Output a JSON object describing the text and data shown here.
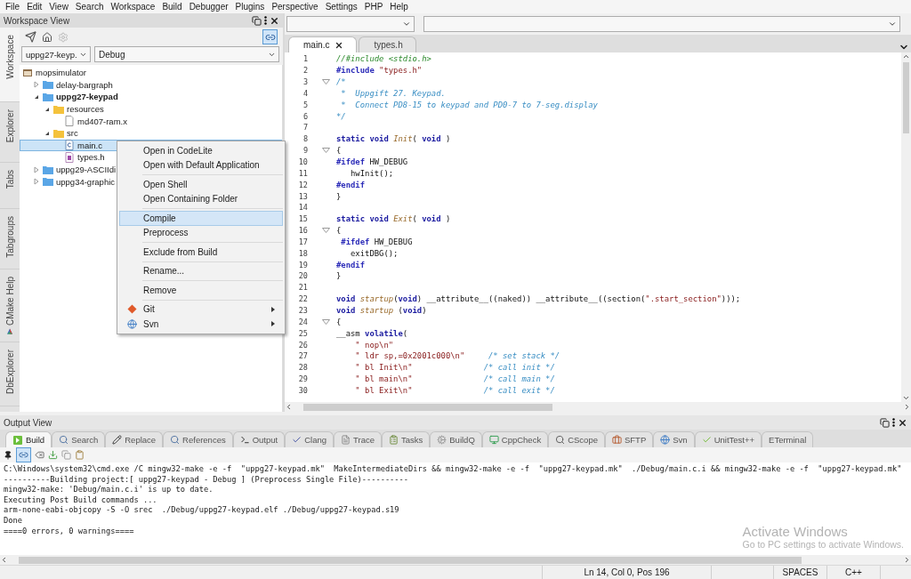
{
  "menu_bar": [
    "File",
    "Edit",
    "View",
    "Search",
    "Workspace",
    "Build",
    "Debugger",
    "Plugins",
    "Perspective",
    "Settings",
    "PHP",
    "Help"
  ],
  "workspace_view": {
    "title": "Workspace View",
    "side_tabs": [
      {
        "label": "Workspace",
        "selected": true
      },
      {
        "label": "Explorer",
        "selected": false
      },
      {
        "label": "Tabs",
        "selected": false
      },
      {
        "label": "Tabgroups",
        "selected": false
      },
      {
        "label": "CMake Help",
        "selected": false
      },
      {
        "label": "DbExplorer",
        "selected": false
      }
    ],
    "link_editor": {
      "on": true
    },
    "project_combo": {
      "value": "uppg27-keyp."
    },
    "config_combo": {
      "value": "Debug"
    },
    "tree": [
      {
        "label": "mopsimulator",
        "kind": "workspace",
        "selected": false,
        "children": [
          {
            "label": "delay-bargraph",
            "kind": "project",
            "expanded": false,
            "active": false,
            "selected": false
          },
          {
            "label": "uppg27-keypad",
            "kind": "project",
            "expanded": true,
            "active": true,
            "selected": false,
            "children": [
              {
                "label": "resources",
                "kind": "folder",
                "expanded": true,
                "selected": false,
                "children": [
                  {
                    "label": "md407-ram.x",
                    "kind": "file",
                    "selected": false
                  }
                ]
              },
              {
                "label": "src",
                "kind": "folder",
                "expanded": true,
                "selected": false,
                "children": [
                  {
                    "label": "main.c",
                    "kind": "c_source",
                    "selected": true
                  },
                  {
                    "label": "types.h",
                    "kind": "header",
                    "selected": false
                  }
                ]
              }
            ]
          },
          {
            "label": "uppg29-ASCIIdi",
            "kind": "project",
            "expanded": false,
            "active": false,
            "selected": false
          },
          {
            "label": "uppg34-graphic",
            "kind": "project",
            "expanded": false,
            "active": false,
            "selected": false
          }
        ]
      }
    ]
  },
  "context_menu": [
    [
      {
        "label": "Open in CodeLite",
        "selected": false,
        "submenu": false
      },
      {
        "label": "Open with Default Application",
        "selected": false,
        "submenu": false
      }
    ],
    [
      {
        "label": "Open Shell",
        "selected": false,
        "submenu": false
      },
      {
        "label": "Open Containing Folder",
        "selected": false,
        "submenu": false
      }
    ],
    [
      {
        "label": "Compile",
        "selected": true,
        "submenu": false
      },
      {
        "label": "Preprocess",
        "selected": false,
        "submenu": false
      }
    ],
    [
      {
        "label": "Exclude from Build",
        "selected": false,
        "submenu": false
      }
    ],
    [
      {
        "label": "Rename...",
        "selected": false,
        "submenu": false
      }
    ],
    [
      {
        "label": "Remove",
        "selected": false,
        "submenu": false
      }
    ],
    [
      {
        "label": "Git",
        "selected": false,
        "submenu": true,
        "kind": "git"
      },
      {
        "label": "Svn",
        "selected": false,
        "submenu": true,
        "kind": "svn"
      }
    ]
  ],
  "editor": {
    "tabs": [
      {
        "label": "main.c",
        "selected": true,
        "closable": true
      },
      {
        "label": "types.h",
        "selected": false,
        "closable": false
      }
    ],
    "lines": [
      {
        "number": "1",
        "fold": false,
        "tokens": [
          {
            "kind": "line_comment",
            "text": "//#include <stdio.h>"
          }
        ]
      },
      {
        "number": "2",
        "fold": false,
        "tokens": [
          {
            "kind": "preproc",
            "text": "#include "
          },
          {
            "kind": "string",
            "text": "\"types.h\""
          }
        ]
      },
      {
        "number": "3",
        "fold": true,
        "tokens": [
          {
            "kind": "block_comment",
            "text": "/*"
          }
        ]
      },
      {
        "number": "4",
        "fold": false,
        "tokens": [
          {
            "kind": "block_comment",
            "text": " *  Uppgift 27. Keypad."
          }
        ]
      },
      {
        "number": "5",
        "fold": false,
        "tokens": [
          {
            "kind": "block_comment",
            "text": " *  Connect PD8-15 to keypad and PD0-7 to 7-seg.display"
          }
        ]
      },
      {
        "number": "6",
        "fold": false,
        "tokens": [
          {
            "kind": "block_comment",
            "text": "*/"
          }
        ]
      },
      {
        "number": "7",
        "fold": false
      },
      {
        "number": "8",
        "fold": false,
        "tokens": [
          {
            "kind": "keyword",
            "text": "static void "
          },
          {
            "kind": "function",
            "text": "Init"
          },
          {
            "kind": "plain",
            "text": "( "
          },
          {
            "kind": "keyword",
            "text": "void"
          },
          {
            "kind": "plain",
            "text": " )"
          }
        ]
      },
      {
        "number": "9",
        "fold": true,
        "tokens": [
          {
            "kind": "plain",
            "text": "{"
          }
        ]
      },
      {
        "number": "10",
        "fold": false,
        "tokens": [
          {
            "kind": "preproc",
            "text": "#ifdef "
          },
          {
            "kind": "plain",
            "text": "HW_DEBUG"
          }
        ]
      },
      {
        "number": "11",
        "fold": false,
        "tokens": [
          {
            "kind": "plain",
            "text": "   hwInit();"
          }
        ]
      },
      {
        "number": "12",
        "fold": false,
        "tokens": [
          {
            "kind": "preproc",
            "text": "#endif"
          }
        ]
      },
      {
        "number": "13",
        "fold": false,
        "tokens": [
          {
            "kind": "plain",
            "text": "}"
          }
        ]
      },
      {
        "number": "14",
        "fold": false
      },
      {
        "number": "15",
        "fold": false,
        "tokens": [
          {
            "kind": "keyword",
            "text": "static void "
          },
          {
            "kind": "function",
            "text": "Exit"
          },
          {
            "kind": "plain",
            "text": "( "
          },
          {
            "kind": "keyword",
            "text": "void"
          },
          {
            "kind": "plain",
            "text": " )"
          }
        ]
      },
      {
        "number": "16",
        "fold": true,
        "tokens": [
          {
            "kind": "plain",
            "text": "{"
          }
        ]
      },
      {
        "number": "17",
        "fold": false,
        "tokens": [
          {
            "kind": "preproc",
            "text": " #ifdef "
          },
          {
            "kind": "plain",
            "text": "HW_DEBUG"
          }
        ]
      },
      {
        "number": "18",
        "fold": false,
        "tokens": [
          {
            "kind": "plain",
            "text": "   exitDBG();"
          }
        ]
      },
      {
        "number": "19",
        "fold": false,
        "tokens": [
          {
            "kind": "preproc",
            "text": "#endif"
          }
        ]
      },
      {
        "number": "20",
        "fold": false,
        "tokens": [
          {
            "kind": "plain",
            "text": "}"
          }
        ]
      },
      {
        "number": "21",
        "fold": false
      },
      {
        "number": "22",
        "fold": false,
        "tokens": [
          {
            "kind": "keyword",
            "text": "void "
          },
          {
            "kind": "function",
            "text": "startup"
          },
          {
            "kind": "plain",
            "text": "("
          },
          {
            "kind": "keyword",
            "text": "void"
          },
          {
            "kind": "plain",
            "text": ") __attribute__((naked)) __attribute__((section("
          },
          {
            "kind": "string",
            "text": "\".start_section\""
          },
          {
            "kind": "plain",
            "text": ")));"
          }
        ]
      },
      {
        "number": "23",
        "fold": false,
        "tokens": [
          {
            "kind": "keyword",
            "text": "void "
          },
          {
            "kind": "function",
            "text": "startup"
          },
          {
            "kind": "plain",
            "text": " ("
          },
          {
            "kind": "keyword",
            "text": "void"
          },
          {
            "kind": "plain",
            "text": ")"
          }
        ]
      },
      {
        "number": "24",
        "fold": true,
        "tokens": [
          {
            "kind": "plain",
            "text": "{"
          }
        ]
      },
      {
        "number": "25",
        "fold": false,
        "tokens": [
          {
            "kind": "plain",
            "text": "__asm "
          },
          {
            "kind": "keyword",
            "text": "volatile"
          },
          {
            "kind": "plain",
            "text": "("
          }
        ]
      },
      {
        "number": "26",
        "fold": false,
        "tokens": [
          {
            "kind": "string",
            "text": "    \" nop\\n\""
          }
        ]
      },
      {
        "number": "27",
        "fold": false,
        "tokens": [
          {
            "kind": "string",
            "text": "    \" ldr sp,=0x2001c000\\n\""
          },
          {
            "kind": "block_comment",
            "text": "     /* set stack */"
          }
        ]
      },
      {
        "number": "28",
        "fold": false,
        "tokens": [
          {
            "kind": "string",
            "text": "    \" bl Init\\n\""
          },
          {
            "kind": "block_comment",
            "text": "               /* call init */"
          }
        ]
      },
      {
        "number": "29",
        "fold": false,
        "tokens": [
          {
            "kind": "string",
            "text": "    \" bl main\\n\""
          },
          {
            "kind": "block_comment",
            "text": "               /* call main */"
          }
        ]
      },
      {
        "number": "30",
        "fold": false,
        "tokens": [
          {
            "kind": "string",
            "text": "    \" bl Exit\\n\""
          },
          {
            "kind": "block_comment",
            "text": "               /* call exit */"
          }
        ]
      }
    ]
  },
  "output_view": {
    "title": "Output View",
    "tabs": [
      {
        "label": "Build",
        "selected": true
      },
      {
        "label": "Search",
        "selected": false
      },
      {
        "label": "Replace",
        "selected": false
      },
      {
        "label": "References",
        "selected": false
      },
      {
        "label": "Output",
        "selected": false
      },
      {
        "label": "Clang",
        "selected": false
      },
      {
        "label": "Trace",
        "selected": false
      },
      {
        "label": "Tasks",
        "selected": false
      },
      {
        "label": "BuildQ",
        "selected": false
      },
      {
        "label": "CppCheck",
        "selected": false
      },
      {
        "label": "CScope",
        "selected": false
      },
      {
        "label": "SFTP",
        "selected": false
      },
      {
        "label": "Svn",
        "selected": false
      },
      {
        "label": "UnitTest++",
        "selected": false
      },
      {
        "label": "ETerminal",
        "selected": false
      }
    ],
    "link_toggle": {
      "on": true
    },
    "lines": [
      "C:\\Windows\\system32\\cmd.exe /C mingw32-make -e -f  \"uppg27-keypad.mk\"  MakeIntermediateDirs && mingw32-make -e -f  \"uppg27-keypad.mk\"  ./Debug/main.c.i && mingw32-make -e -f  \"uppg27-keypad.mk\"",
      "----------Building project:[ uppg27-keypad - Debug ] (Preprocess Single File)----------",
      "mingw32-make: 'Debug/main.c.i' is up to date.",
      "Executing Post Build commands ...",
      "arm-none-eabi-objcopy -S -O srec  ./Debug/uppg27-keypad.elf ./Debug/uppg27-keypad.s19",
      "Done",
      "====0 errors, 0 warnings===="
    ]
  },
  "os_notice": {
    "title": "Activate Windows",
    "text": "Go to PC settings to activate Windows."
  },
  "status_bar": [
    "Ln 14, Col 0, Pos 196",
    "SPACES",
    "C++"
  ]
}
